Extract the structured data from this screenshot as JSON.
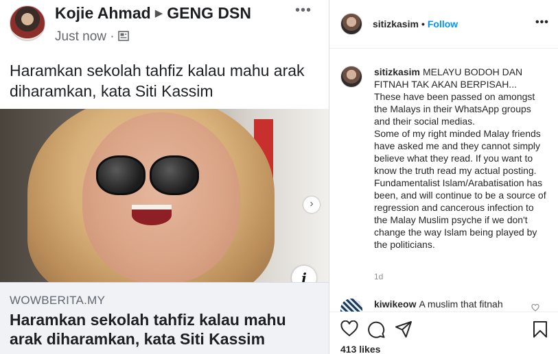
{
  "facebook_post": {
    "author": "Kojie Ahmad",
    "separator": "▶",
    "group": "GENG DSN",
    "time": "Just now",
    "privacy_sep": "·",
    "more": "•••",
    "headline": "Haramkan sekolah tahfiz kalau mahu arak diharamkan, kata Siti Kassim",
    "link_domain": "WOWBERITA.MY",
    "link_title": "Haramkan sekolah tahfiz kalau mahu arak diharamkan, kata Siti Kassim",
    "info_glyph": "i",
    "next_glyph": "›"
  },
  "instagram": {
    "username": "sitizkasim",
    "dot": "•",
    "follow": "Follow",
    "more": "•••",
    "caption_user": "sitizkasim",
    "caption_lines": [
      "MELAYU BODOH DAN FITNAH TAK AKAN BERPISAH...",
      "These have been passed on amongst the Malays in their WhatsApp groups and their social medias.",
      "Some of my right minded Malay friends have asked me and they cannot simply believe what they read. If you want to know the truth read my actual posting.",
      "Fundamentalist Islam/Arabatisation has been, and will continue to be a source of regression and cancerous infection to the Malay Muslim psyche if we don't change the way Islam being played by the politicians."
    ],
    "age": "1d",
    "comment_user": "kiwikeow",
    "comment_text": "A muslim that fitnah",
    "likes": "413 likes"
  }
}
